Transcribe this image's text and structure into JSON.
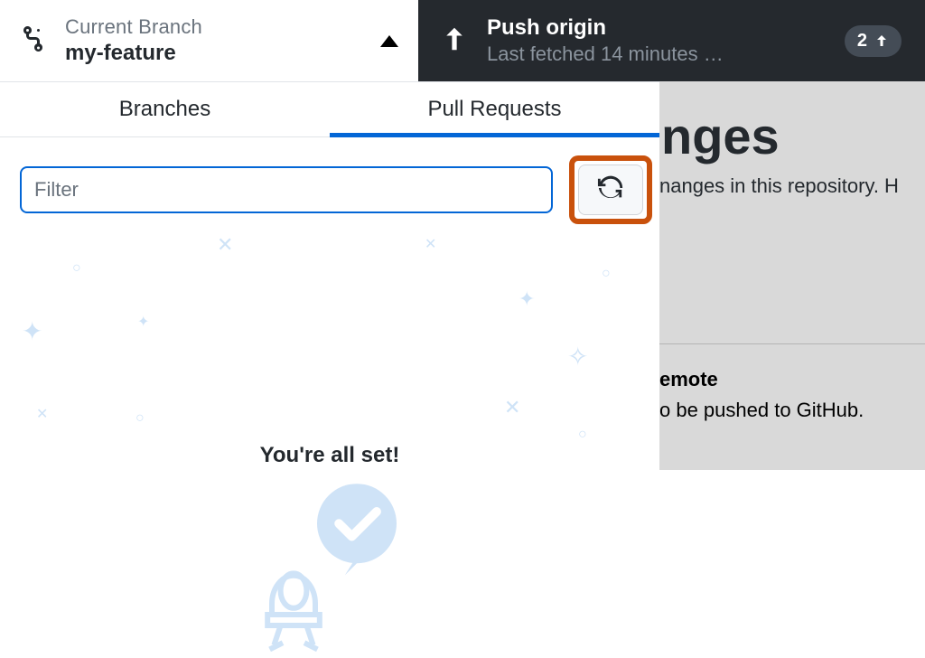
{
  "branch": {
    "label": "Current Branch",
    "name": "my-feature"
  },
  "push": {
    "title": "Push origin",
    "subtitle": "Last fetched 14 minutes …",
    "badge_count": "2"
  },
  "tabs": {
    "branches": "Branches",
    "pull_requests": "Pull Requests"
  },
  "filter": {
    "placeholder": "Filter"
  },
  "empty": {
    "title": "You're all set!"
  },
  "bg": {
    "heading_fragment": "nges",
    "line1_fragment": "nanges in this repository. H",
    "remote_heading_fragment": "emote",
    "remote_line_fragment": "o be pushed to GitHub."
  }
}
